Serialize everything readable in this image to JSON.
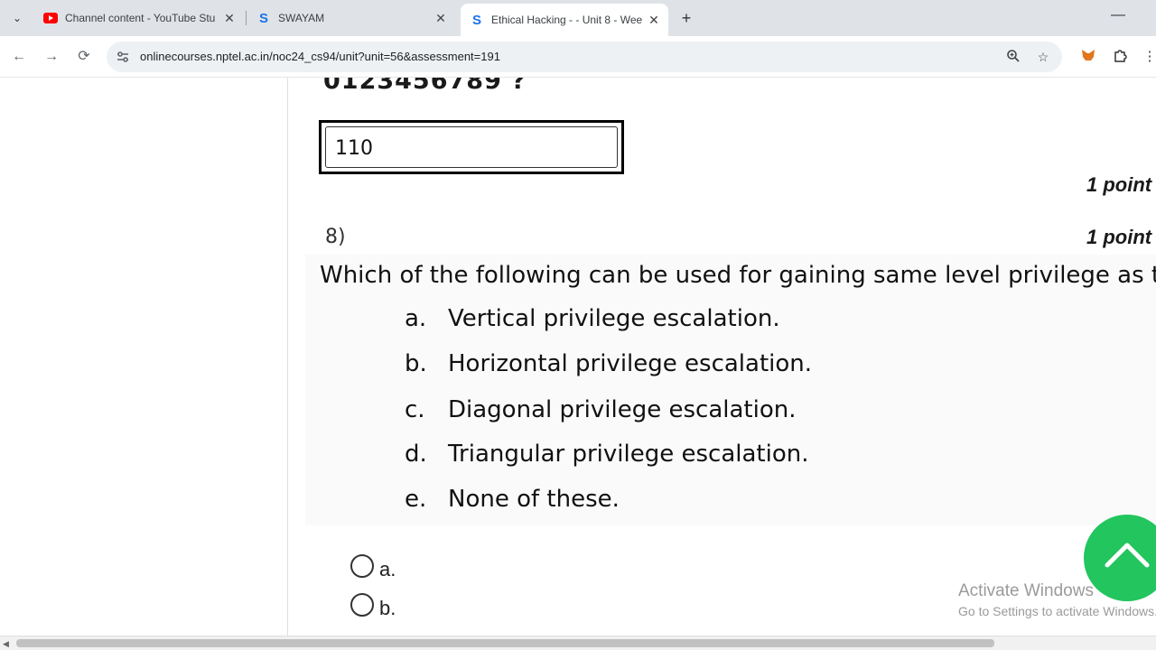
{
  "browser": {
    "tabs": [
      {
        "title": "Channel content - YouTube Stu",
        "icon": "youtube-icon"
      },
      {
        "title": "SWAYAM",
        "icon": "swayam-icon"
      },
      {
        "title": "Ethical Hacking - - Unit 8 - Wee",
        "icon": "swayam-icon",
        "active": true
      }
    ],
    "url": "onlinecourses.nptel.ac.in/noc24_cs94/unit?unit=56&assessment=191"
  },
  "page": {
    "prev_question_tail": "0123456789  ?",
    "prev_answer": "110",
    "prev_points": "1 point",
    "question": {
      "number": "8)",
      "points": "1 point",
      "text": "Which of the following can be used for gaining same level privilege as th",
      "options": [
        {
          "letter": "a.",
          "text": "Vertical privilege escalation."
        },
        {
          "letter": "b.",
          "text": "Horizontal privilege escalation."
        },
        {
          "letter": "c.",
          "text": "Diagonal privilege escalation."
        },
        {
          "letter": "d.",
          "text": "Triangular privilege escalation."
        },
        {
          "letter": "e.",
          "text": "None of these."
        }
      ],
      "answer_choices": [
        "a.",
        "b."
      ]
    }
  },
  "watermark": {
    "line1": "Activate Windows",
    "line2": "Go to Settings to activate Windows."
  },
  "colors": {
    "accent_green": "#22c55e",
    "youtube_red": "#ff0000",
    "swayam_blue": "#1a73e8"
  }
}
